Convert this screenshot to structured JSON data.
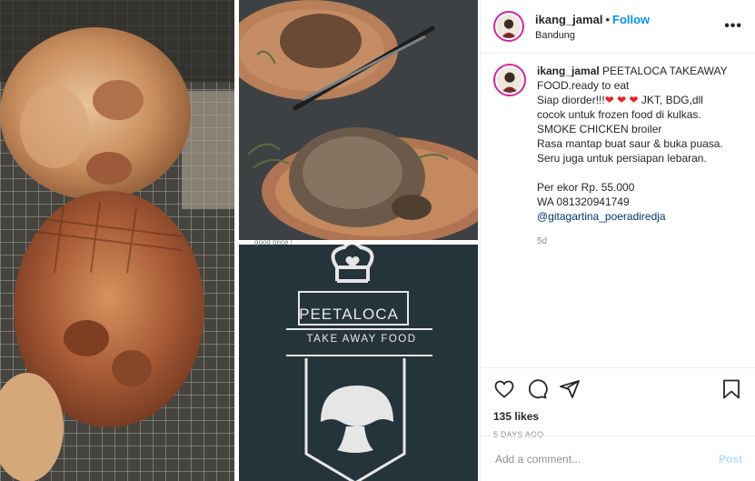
{
  "post": {
    "username": "ikang_jamal",
    "follow_label": "Follow",
    "location": "Bandung",
    "more_label": "•••",
    "separator": "•"
  },
  "caption": {
    "username": "ikang_jamal",
    "line1_text": "PEETALOCA TAKEAWAY",
    "line2": "FOOD.ready to eat",
    "line3_prefix": "Siap diorder!!!",
    "hearts": "❤ ❤ ❤",
    "line3_suffix": " JKT, BDG,dll",
    "line4": "cocok untuk frozen food di kulkas.",
    "line5": "SMOKE CHICKEN broiler",
    "line6": "Rasa mantap buat saur & buka puasa.",
    "line7": "Seru juga untuk persiapan lebaran.",
    "line8": "Per ekor Rp. 55.000",
    "line9": "WA 081320941749",
    "mention": "@gitagartina_poeradiredja",
    "time": "5d"
  },
  "actions": {
    "icons": [
      "heart-icon",
      "comment-icon",
      "share-icon",
      "bookmark-icon"
    ],
    "likes": "135 likes",
    "date": "5 DAYS AGO"
  },
  "comment": {
    "placeholder": "Add a comment...",
    "post_label": "Post"
  },
  "media": {
    "logo_title": "PEETALOCA",
    "logo_subtitle": "TAKE AWAY FOOD",
    "watermark": "good price !"
  },
  "colors": {
    "follow": "#0095f6",
    "mention": "#00376b",
    "post_disabled": "#b2dffc",
    "muted": "#8e8e8e",
    "heart": "#ed1c24"
  }
}
